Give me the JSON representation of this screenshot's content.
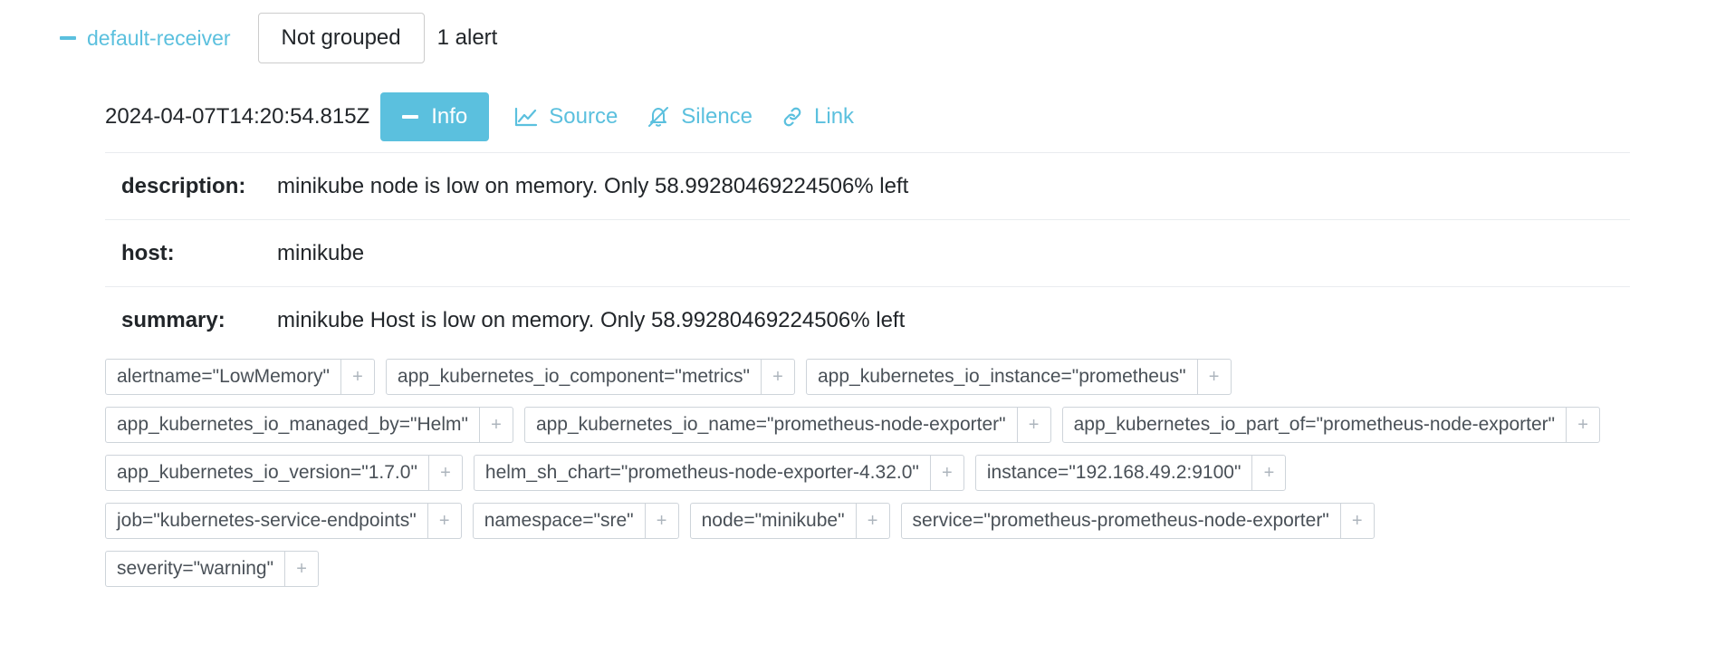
{
  "group": {
    "receiver": "default-receiver",
    "grouping_button": "Not grouped",
    "alert_count": "1 alert"
  },
  "alert": {
    "timestamp": "2024-04-07T14:20:54.815Z",
    "actions": {
      "info": "Info",
      "source": "Source",
      "silence": "Silence",
      "link": "Link"
    },
    "annotations": [
      {
        "key": "description:",
        "value": "minikube node is low on memory. Only 58.99280469224506% left"
      },
      {
        "key": "host:",
        "value": "minikube"
      },
      {
        "key": "summary:",
        "value": "minikube Host is low on memory. Only 58.99280469224506% left"
      }
    ],
    "labels": [
      [
        "alertname=\"LowMemory\"",
        "app_kubernetes_io_component=\"metrics\"",
        "app_kubernetes_io_instance=\"prometheus\""
      ],
      [
        "app_kubernetes_io_managed_by=\"Helm\"",
        "app_kubernetes_io_name=\"prometheus-node-exporter\"",
        "app_kubernetes_io_part_of=\"prometheus-node-exporter\""
      ],
      [
        "app_kubernetes_io_version=\"1.7.0\"",
        "helm_sh_chart=\"prometheus-node-exporter-4.32.0\"",
        "instance=\"192.168.49.2:9100\""
      ],
      [
        "job=\"kubernetes-service-endpoints\"",
        "namespace=\"sre\"",
        "node=\"minikube\"",
        "service=\"prometheus-prometheus-node-exporter\""
      ],
      [
        "severity=\"warning\""
      ]
    ],
    "label_add_glyph": "+"
  },
  "colors": {
    "accent": "#5bc0de",
    "text": "#212529",
    "border": "#ced4da"
  }
}
